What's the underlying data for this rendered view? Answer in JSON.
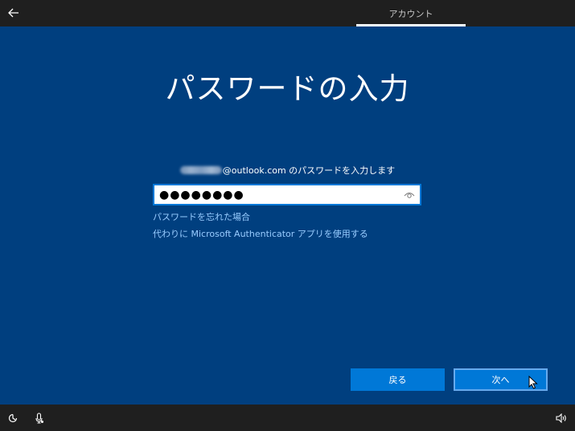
{
  "header": {
    "tab_label": "アカウント"
  },
  "main": {
    "title": "パスワードの入力",
    "prompt_suffix": "@outlook.com のパスワードを入力します",
    "password_value": "●●●●●●●●",
    "forgot_link": "パスワードを忘れた場合",
    "authenticator_link": "代わりに Microsoft Authenticator アプリを使用する"
  },
  "footer_buttons": {
    "back_label": "戻る",
    "next_label": "次へ"
  },
  "colors": {
    "background": "#003f7f",
    "accent": "#0078d7",
    "link": "#99ccff",
    "bar": "#1f1f1f"
  },
  "icons": {
    "back": "arrow-left-icon",
    "reveal": "eye-icon",
    "ease_of_access": "ease-of-access-icon",
    "microphone": "microphone-icon",
    "volume": "volume-icon"
  }
}
